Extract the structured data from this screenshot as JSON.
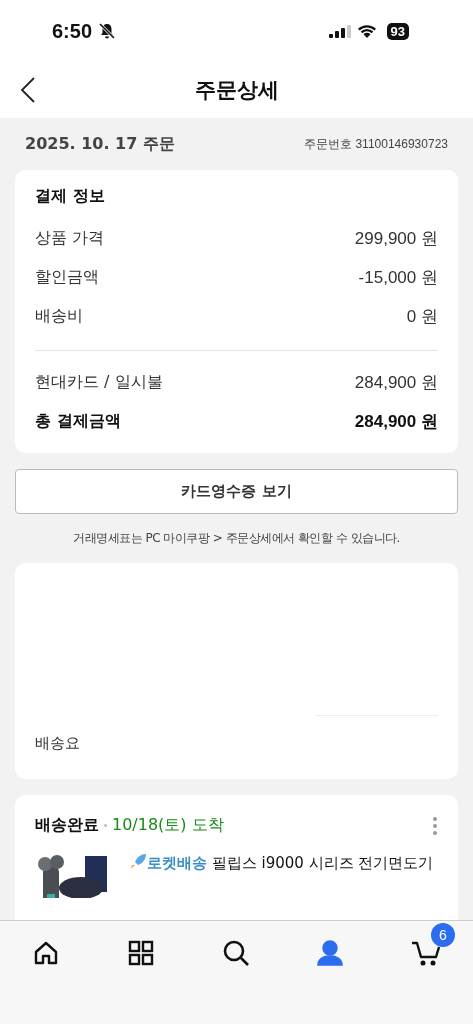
{
  "status_bar": {
    "time": "6:50",
    "battery": "93"
  },
  "header": {
    "title": "주문상세"
  },
  "order": {
    "date": "2025. 10. 17 주문",
    "number": "주문번호 31100146930723"
  },
  "payment": {
    "title": "결제 정보",
    "rows": [
      {
        "label": "상품 가격",
        "value": "299,900 원"
      },
      {
        "label": "할인금액",
        "value": "-15,000 원"
      },
      {
        "label": "배송비",
        "value": "0 원"
      }
    ],
    "method": {
      "label": "현대카드 / 일시불",
      "value": "284,900 원"
    },
    "total": {
      "label": "총 결제금액",
      "value": "284,900 원"
    }
  },
  "receipt_button": "카드영수증 보기",
  "notice": "거래명세표는 PC 마이쿠팡 > 주문상세에서 확인할 수 있습니다.",
  "address_card": {
    "label": "배송요"
  },
  "shipment": {
    "status": "배송완료",
    "arrival": "10/18(토) 도착",
    "badge": "로켓배송",
    "product": "필립스 i9000 시리즈 전기면도기"
  },
  "tab_bar": [
    {
      "kind": "home",
      "selected": false
    },
    {
      "kind": "categories",
      "selected": false
    },
    {
      "kind": "search",
      "selected": false
    },
    {
      "kind": "profile",
      "selected": true
    },
    {
      "kind": "cart",
      "selected": false,
      "badge": "6"
    }
  ]
}
